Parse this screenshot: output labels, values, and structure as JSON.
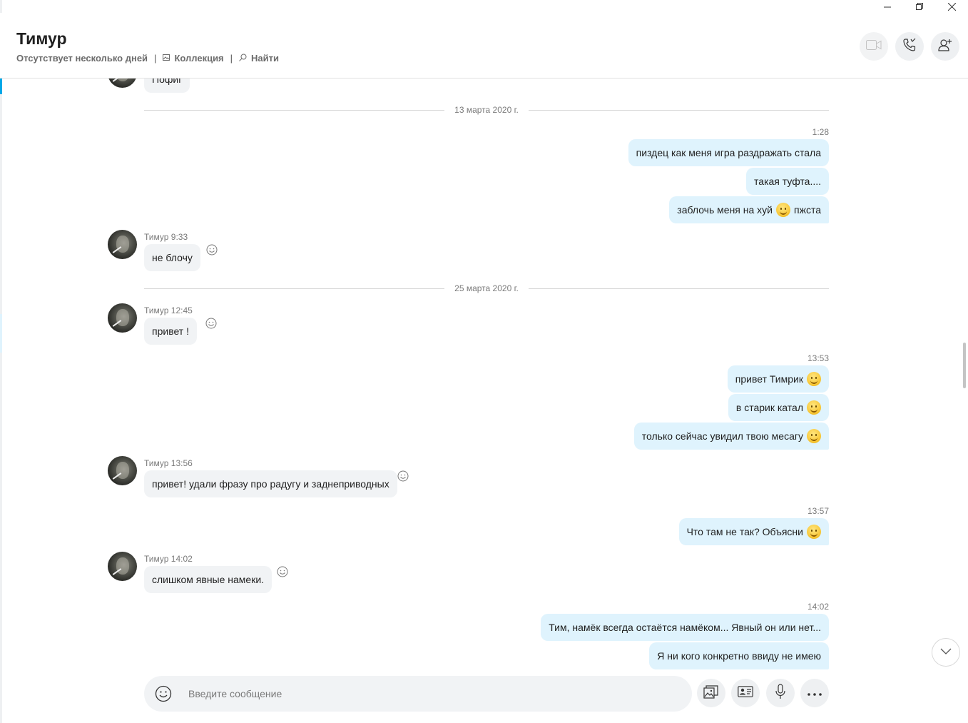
{
  "window": {
    "minimize": "—",
    "restore": "❐",
    "close": "✕"
  },
  "header": {
    "title": "Тимур",
    "status": "Отсутствует несколько дней",
    "collection_label": "Коллекция",
    "find_label": "Найти",
    "separator": "|"
  },
  "chat": {
    "partial_top_message": "Пофиг",
    "dividers": [
      "13 марта 2020 г.",
      "25 марта 2020 г."
    ],
    "groups": [
      {
        "time": "1:28",
        "messages": [
          "пиздец как меня игра раздражать стала",
          "такая туфта....",
          "заблочь меня на хуй",
          "пжста"
        ]
      },
      {
        "sender": "Тимур",
        "time": "9:33",
        "messages": [
          "не блочу"
        ]
      },
      {
        "sender": "Тимур",
        "time": "12:45",
        "messages": [
          "привет !"
        ]
      },
      {
        "time": "13:53",
        "messages": [
          "привет Тимрик",
          "в старик катал",
          "только сейчас увидил твою месагу"
        ]
      },
      {
        "sender": "Тимур",
        "time": "13:56",
        "messages": [
          "привет! удали фразу про радугу и заднеприводных"
        ]
      },
      {
        "time": "13:57",
        "messages": [
          "Что там не так? Объясни"
        ]
      },
      {
        "sender": "Тимур",
        "time": "14:02",
        "messages": [
          "слишком явные намеки."
        ]
      },
      {
        "time": "14:02",
        "messages": [
          "Тим, намёк всегда остаётся намёком... Явный он или нет...",
          "Я ни кого конкретно ввиду не имею"
        ]
      }
    ]
  },
  "composer": {
    "placeholder": "Введите сообщение"
  },
  "icons": [
    "video-call-icon",
    "audio-call-icon",
    "add-person-icon",
    "emoji-icon",
    "media-icon",
    "contact-card-icon",
    "microphone-icon",
    "more-icon",
    "chevron-down-icon"
  ]
}
